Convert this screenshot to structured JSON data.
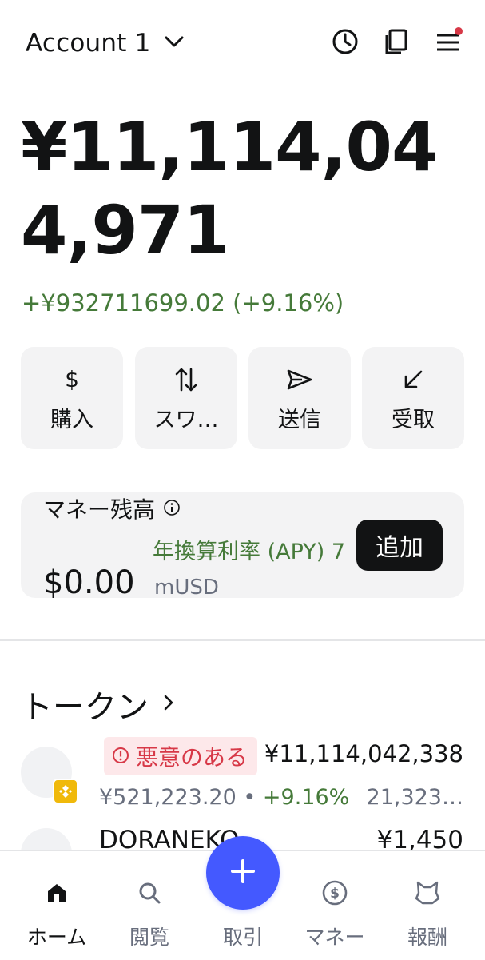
{
  "header": {
    "account_name": "Account 1",
    "icons": [
      "chevron-down-icon",
      "activity-clock-icon",
      "copy-icon",
      "menu-icon"
    ],
    "notification_dot_color": "#d73847"
  },
  "balance": {
    "amount": "¥11,114,044,971",
    "change": "+¥932711699.02 (+9.16%)"
  },
  "actions": [
    {
      "label": "購入",
      "icon": "dollar-icon"
    },
    {
      "label": "スワ…",
      "icon": "swap-icon"
    },
    {
      "label": "送信",
      "icon": "send-icon"
    },
    {
      "label": "受取",
      "icon": "receive-icon"
    }
  ],
  "money": {
    "title": "マネー残高",
    "apy": "年換算利率 (APY) 7",
    "amount": "$0.00",
    "unit": "mUSD",
    "add_label": "追加"
  },
  "tokens": {
    "title": "トークン",
    "items": [
      {
        "warning": "悪意のある",
        "value": "¥11,114,042,338",
        "price": "¥521,223.20",
        "separator": "•",
        "change": "+9.16%",
        "quantity": "21,323…",
        "network_badge": "bnb-chain-icon"
      },
      {
        "name": "DORANEKO",
        "value": "¥1,450"
      }
    ]
  },
  "nav": [
    {
      "label": "ホーム",
      "icon": "home-icon",
      "active": true
    },
    {
      "label": "閲覧",
      "icon": "search-icon"
    },
    {
      "label": "取引",
      "icon": "plus-icon"
    },
    {
      "label": "マネー",
      "icon": "dollar-circle-icon"
    },
    {
      "label": "報酬",
      "icon": "fox-icon"
    }
  ],
  "colors": {
    "positive": "#457a39",
    "danger": "#d73847",
    "accent": "#4459ff",
    "text": "#121314",
    "muted": "#686e7d",
    "card": "#f3f3f4"
  }
}
